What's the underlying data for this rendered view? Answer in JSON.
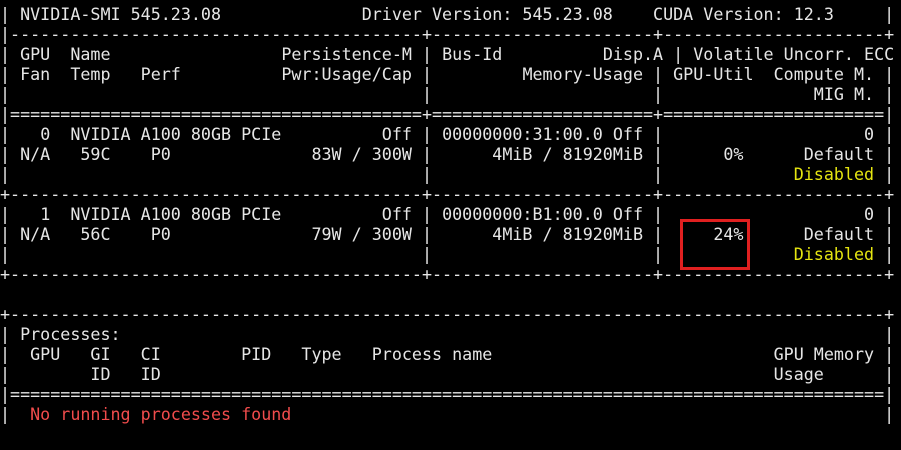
{
  "smi": {
    "title": "NVIDIA-SMI 545.23.08",
    "driver": "Driver Version: 545.23.08",
    "cuda": "CUDA Version: 12.3",
    "header_row1": {
      "gpu": "GPU",
      "name": "Name",
      "persistence": "Persistence-M",
      "busid": "Bus-Id",
      "dispa": "Disp.A",
      "volatile": "Volatile Uncorr. ECC"
    },
    "header_row2": {
      "fan": "Fan",
      "temp": "Temp",
      "perf": "Perf",
      "pwr": "Pwr:Usage/Cap",
      "memusage": "Memory-Usage",
      "gpuutil": "GPU-Util",
      "compute": "Compute M."
    },
    "header_row3": {
      "mig": "MIG M."
    }
  },
  "gpus": [
    {
      "index": "0",
      "name": "NVIDIA A100 80GB PCIe",
      "persistence": "Off",
      "bus_id": "00000000:31:00.0",
      "disp": "Off",
      "ecc": "0",
      "fan": "N/A",
      "temp": "59C",
      "perf": "P0",
      "power": "83W / 300W",
      "memory": "4MiB / 81920MiB",
      "util": "0%",
      "compute_mode": "Default",
      "mig": "Disabled"
    },
    {
      "index": "1",
      "name": "NVIDIA A100 80GB PCIe",
      "persistence": "Off",
      "bus_id": "00000000:B1:00.0",
      "disp": "Off",
      "ecc": "0",
      "fan": "N/A",
      "temp": "56C",
      "perf": "P0",
      "power": "79W / 300W",
      "memory": "4MiB / 81920MiB",
      "util": "24%",
      "compute_mode": "Default",
      "mig": "Disabled"
    }
  ],
  "processes": {
    "title": "Processes:",
    "col_gpu": "GPU",
    "col_gi": "GI",
    "col_ci": "CI",
    "col_gi2": "ID",
    "col_ci2": "ID",
    "col_pid": "PID",
    "col_type": "Type",
    "col_name": "Process name",
    "col_mem1": "GPU Memory",
    "col_mem2": "Usage",
    "empty_message": "No running processes found"
  },
  "colors": {
    "background": "#000000",
    "text": "#e6e6e6",
    "mig_status": "#e5e510",
    "empty_message": "#f14c4c",
    "highlight": "#e02020"
  }
}
